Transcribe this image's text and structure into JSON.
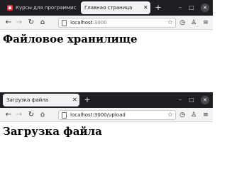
{
  "window_top": {
    "tabs": [
      {
        "title": "Курсы для программис",
        "active": false,
        "close": "✕"
      },
      {
        "title": "Главная страница",
        "active": true,
        "close": "✕"
      }
    ],
    "new_tab": "+",
    "controls": {
      "minimize": "–",
      "maximize": "□",
      "close": "✕"
    },
    "nav": {
      "back": "←",
      "forward": "→",
      "reload": "↻",
      "home": "⌂"
    },
    "url": {
      "host": "localhost",
      "port": ":3000",
      "path": ""
    },
    "tools": {
      "bookmark": "☆",
      "history": "◷",
      "account": "♙",
      "menu": "≡"
    },
    "page": {
      "heading": "Файловое хранилище"
    }
  },
  "window_bottom": {
    "tabs": [
      {
        "title": "Загрузка файла",
        "active": true,
        "close": "✕"
      }
    ],
    "new_tab": "+",
    "controls": {
      "minimize": "–",
      "maximize": "□",
      "close": "✕"
    },
    "nav": {
      "back": "←",
      "forward": "→",
      "reload": "↻",
      "home": "⌂"
    },
    "url": {
      "host": "localhost",
      "port": ":3000",
      "path": "/upload"
    },
    "tools": {
      "bookmark": "☆",
      "history": "◷",
      "account": "♙",
      "menu": "≡"
    },
    "page": {
      "heading": "Загрузка файла"
    }
  },
  "colors": {
    "titlebar": "#1f1f23",
    "toolbar": "#f2f2f4",
    "favicon": "#e4343a"
  }
}
